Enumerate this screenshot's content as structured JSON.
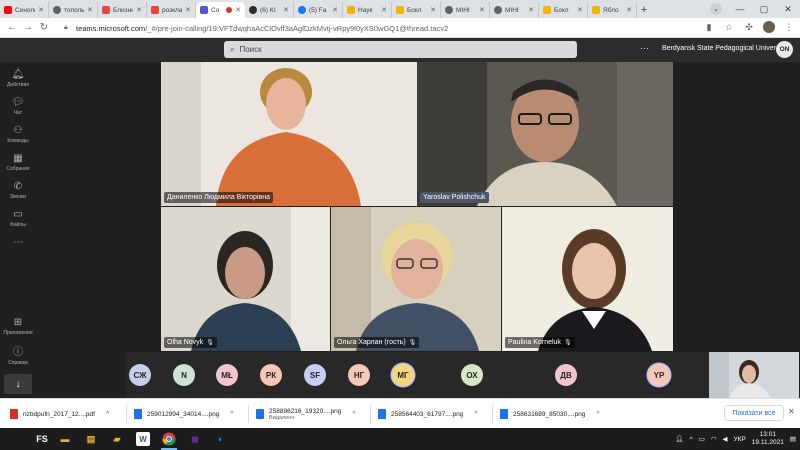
{
  "browser": {
    "tabs": [
      {
        "title": "Синопсис",
        "favicon_color": "#ff0000",
        "active": false
      },
      {
        "title": "тополь",
        "favicon_color": "#5f6368",
        "active": false
      },
      {
        "title": "Близнюк",
        "favicon_color": "#e8453c",
        "active": false
      },
      {
        "title": "розклад",
        "favicon_color": "#ea4335",
        "active": false
      },
      {
        "title": "Co",
        "favicon_color": "#5059c9",
        "active": true
      },
      {
        "title": "(6) Kl",
        "favicon_color": "#2b2b2b",
        "active": false
      },
      {
        "title": "(5) Fa",
        "favicon_color": "#1877f2",
        "active": false
      },
      {
        "title": "Наук",
        "favicon_color": "#f4b400",
        "active": false
      },
      {
        "title": "Бокл",
        "favicon_color": "#f4b400",
        "active": false
      },
      {
        "title": "МІНІ",
        "favicon_color": "#5f6368",
        "active": false
      },
      {
        "title": "МІНІ",
        "favicon_color": "#5f6368",
        "active": false
      },
      {
        "title": "Бокл",
        "favicon_color": "#f4b400",
        "active": false
      },
      {
        "title": "Ябло",
        "favicon_color": "#f4b400",
        "active": false
      }
    ],
    "url_host": "teams.microsoft.com",
    "url_path": "/_#/pre-join-calling/19:VFTdwqhaAcClOvff3aAglDzkMvtj-vRpy9l0yXS0wGQ1@thread.tacv2"
  },
  "teams": {
    "search_placeholder": "Поиск",
    "org_name": "Berdyansk State Pedagogical University",
    "me_initials": "ON",
    "rail": [
      {
        "label": "Действия",
        "icon": "bell-icon"
      },
      {
        "label": "Чат",
        "icon": "chat-icon"
      },
      {
        "label": "Команды",
        "icon": "teams-icon"
      },
      {
        "label": "Собрания",
        "icon": "calendar-icon"
      },
      {
        "label": "Звонки",
        "icon": "phone-icon"
      },
      {
        "label": "Файлы",
        "icon": "file-icon"
      },
      {
        "label": "",
        "icon": "more-icon"
      },
      {
        "label": "Приложения",
        "icon": "apps-icon"
      },
      {
        "label": "Справка",
        "icon": "help-icon"
      }
    ]
  },
  "meeting": {
    "participants": [
      {
        "name": "Даниленко Людмила Вікторівна",
        "muted": false
      },
      {
        "name": "Yaroslav Polishchuk",
        "muted": false
      },
      {
        "name": "Olha Novyk",
        "muted": true
      },
      {
        "name": "Ольга Харлан (гость)",
        "muted": true
      },
      {
        "name": "Paulina Korneluk",
        "muted": true
      }
    ],
    "roster": [
      {
        "initials": "СЖ",
        "color": "#c8cfe8"
      },
      {
        "initials": "N",
        "color": "#cde3d3"
      },
      {
        "initials": "МŁ",
        "color": "#f3c6cf"
      },
      {
        "initials": "РК",
        "color": "#f7c6b5"
      },
      {
        "initials": "SF",
        "color": "#c9ccf3"
      },
      {
        "initials": "НГ",
        "color": "#f8c8b6"
      },
      {
        "initials": "МГ",
        "color": "#f5d77a"
      },
      {
        "initials": "ОХ",
        "color": "#d6e6c7"
      },
      {
        "initials": "ДВ",
        "color": "#f3c6cf"
      },
      {
        "initials": "YP",
        "color": "#f8c8b6"
      }
    ]
  },
  "downloads": [
    {
      "name": "nzbdpufn_2017_12....pdf",
      "sub": "",
      "type_color": "#d93025"
    },
    {
      "name": "259012994_34014....png",
      "sub": "",
      "type_color": "#1a73e8"
    },
    {
      "name": "258896216_19320....png",
      "sub": "Видалено",
      "type_color": "#1a73e8"
    },
    {
      "name": "258564403_61797....png",
      "sub": "",
      "type_color": "#1a73e8"
    },
    {
      "name": "258631689_85030....png",
      "sub": "",
      "type_color": "#1a73e8"
    }
  ],
  "downloads_show_all": "Показати все",
  "taskbar": {
    "lang": "УКР",
    "time": "13:01",
    "date": "19.11.2021",
    "fs_label": "FS"
  }
}
